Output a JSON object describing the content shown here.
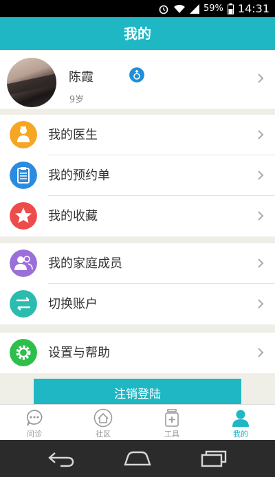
{
  "status_bar": {
    "battery": "59%",
    "time": "14:31"
  },
  "title": "我的",
  "profile": {
    "name": "陈霞",
    "age": "9岁"
  },
  "menu_groups": [
    [
      {
        "label": "我的医生",
        "icon": "doctor-icon",
        "color": "#f5a623"
      },
      {
        "label": "我的预约单",
        "icon": "clipboard-icon",
        "color": "#2a8be0"
      },
      {
        "label": "我的收藏",
        "icon": "star-icon",
        "color": "#ee4b4b"
      }
    ],
    [
      {
        "label": "我的家庭成员",
        "icon": "family-icon",
        "color": "#9b6fd9"
      },
      {
        "label": "切换账户",
        "icon": "switch-icon",
        "color": "#2bbcb0"
      }
    ],
    [
      {
        "label": "设置与帮助",
        "icon": "gear-icon",
        "color": "#2cbf4a"
      }
    ]
  ],
  "logout_label": "注销登陆",
  "bottom_nav": [
    {
      "label": "问诊",
      "icon": "chat-icon",
      "active": false
    },
    {
      "label": "社区",
      "icon": "home-icon",
      "active": false
    },
    {
      "label": "工具",
      "icon": "tool-icon",
      "active": false
    },
    {
      "label": "我的",
      "icon": "person-icon",
      "active": true
    }
  ],
  "colors": {
    "accent": "#1fb7c4",
    "background": "#efefe8"
  }
}
